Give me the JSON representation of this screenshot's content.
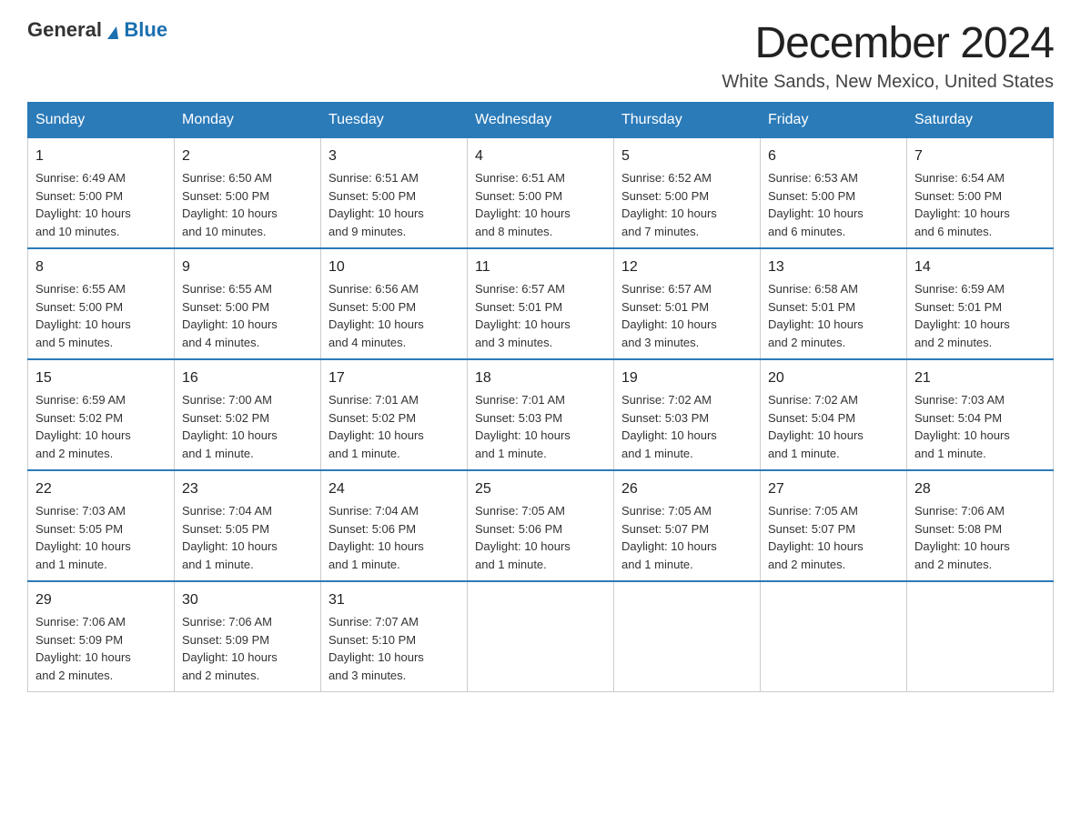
{
  "logo": {
    "text_general": "General",
    "text_blue": "Blue"
  },
  "header": {
    "title": "December 2024",
    "subtitle": "White Sands, New Mexico, United States"
  },
  "days_of_week": [
    "Sunday",
    "Monday",
    "Tuesday",
    "Wednesday",
    "Thursday",
    "Friday",
    "Saturday"
  ],
  "weeks": [
    [
      {
        "day": "1",
        "sunrise": "6:49 AM",
        "sunset": "5:00 PM",
        "daylight": "10 hours and 10 minutes."
      },
      {
        "day": "2",
        "sunrise": "6:50 AM",
        "sunset": "5:00 PM",
        "daylight": "10 hours and 10 minutes."
      },
      {
        "day": "3",
        "sunrise": "6:51 AM",
        "sunset": "5:00 PM",
        "daylight": "10 hours and 9 minutes."
      },
      {
        "day": "4",
        "sunrise": "6:51 AM",
        "sunset": "5:00 PM",
        "daylight": "10 hours and 8 minutes."
      },
      {
        "day": "5",
        "sunrise": "6:52 AM",
        "sunset": "5:00 PM",
        "daylight": "10 hours and 7 minutes."
      },
      {
        "day": "6",
        "sunrise": "6:53 AM",
        "sunset": "5:00 PM",
        "daylight": "10 hours and 6 minutes."
      },
      {
        "day": "7",
        "sunrise": "6:54 AM",
        "sunset": "5:00 PM",
        "daylight": "10 hours and 6 minutes."
      }
    ],
    [
      {
        "day": "8",
        "sunrise": "6:55 AM",
        "sunset": "5:00 PM",
        "daylight": "10 hours and 5 minutes."
      },
      {
        "day": "9",
        "sunrise": "6:55 AM",
        "sunset": "5:00 PM",
        "daylight": "10 hours and 4 minutes."
      },
      {
        "day": "10",
        "sunrise": "6:56 AM",
        "sunset": "5:00 PM",
        "daylight": "10 hours and 4 minutes."
      },
      {
        "day": "11",
        "sunrise": "6:57 AM",
        "sunset": "5:01 PM",
        "daylight": "10 hours and 3 minutes."
      },
      {
        "day": "12",
        "sunrise": "6:57 AM",
        "sunset": "5:01 PM",
        "daylight": "10 hours and 3 minutes."
      },
      {
        "day": "13",
        "sunrise": "6:58 AM",
        "sunset": "5:01 PM",
        "daylight": "10 hours and 2 minutes."
      },
      {
        "day": "14",
        "sunrise": "6:59 AM",
        "sunset": "5:01 PM",
        "daylight": "10 hours and 2 minutes."
      }
    ],
    [
      {
        "day": "15",
        "sunrise": "6:59 AM",
        "sunset": "5:02 PM",
        "daylight": "10 hours and 2 minutes."
      },
      {
        "day": "16",
        "sunrise": "7:00 AM",
        "sunset": "5:02 PM",
        "daylight": "10 hours and 1 minute."
      },
      {
        "day": "17",
        "sunrise": "7:01 AM",
        "sunset": "5:02 PM",
        "daylight": "10 hours and 1 minute."
      },
      {
        "day": "18",
        "sunrise": "7:01 AM",
        "sunset": "5:03 PM",
        "daylight": "10 hours and 1 minute."
      },
      {
        "day": "19",
        "sunrise": "7:02 AM",
        "sunset": "5:03 PM",
        "daylight": "10 hours and 1 minute."
      },
      {
        "day": "20",
        "sunrise": "7:02 AM",
        "sunset": "5:04 PM",
        "daylight": "10 hours and 1 minute."
      },
      {
        "day": "21",
        "sunrise": "7:03 AM",
        "sunset": "5:04 PM",
        "daylight": "10 hours and 1 minute."
      }
    ],
    [
      {
        "day": "22",
        "sunrise": "7:03 AM",
        "sunset": "5:05 PM",
        "daylight": "10 hours and 1 minute."
      },
      {
        "day": "23",
        "sunrise": "7:04 AM",
        "sunset": "5:05 PM",
        "daylight": "10 hours and 1 minute."
      },
      {
        "day": "24",
        "sunrise": "7:04 AM",
        "sunset": "5:06 PM",
        "daylight": "10 hours and 1 minute."
      },
      {
        "day": "25",
        "sunrise": "7:05 AM",
        "sunset": "5:06 PM",
        "daylight": "10 hours and 1 minute."
      },
      {
        "day": "26",
        "sunrise": "7:05 AM",
        "sunset": "5:07 PM",
        "daylight": "10 hours and 1 minute."
      },
      {
        "day": "27",
        "sunrise": "7:05 AM",
        "sunset": "5:07 PM",
        "daylight": "10 hours and 2 minutes."
      },
      {
        "day": "28",
        "sunrise": "7:06 AM",
        "sunset": "5:08 PM",
        "daylight": "10 hours and 2 minutes."
      }
    ],
    [
      {
        "day": "29",
        "sunrise": "7:06 AM",
        "sunset": "5:09 PM",
        "daylight": "10 hours and 2 minutes."
      },
      {
        "day": "30",
        "sunrise": "7:06 AM",
        "sunset": "5:09 PM",
        "daylight": "10 hours and 2 minutes."
      },
      {
        "day": "31",
        "sunrise": "7:07 AM",
        "sunset": "5:10 PM",
        "daylight": "10 hours and 3 minutes."
      },
      null,
      null,
      null,
      null
    ]
  ],
  "labels": {
    "sunrise": "Sunrise:",
    "sunset": "Sunset:",
    "daylight": "Daylight:"
  }
}
